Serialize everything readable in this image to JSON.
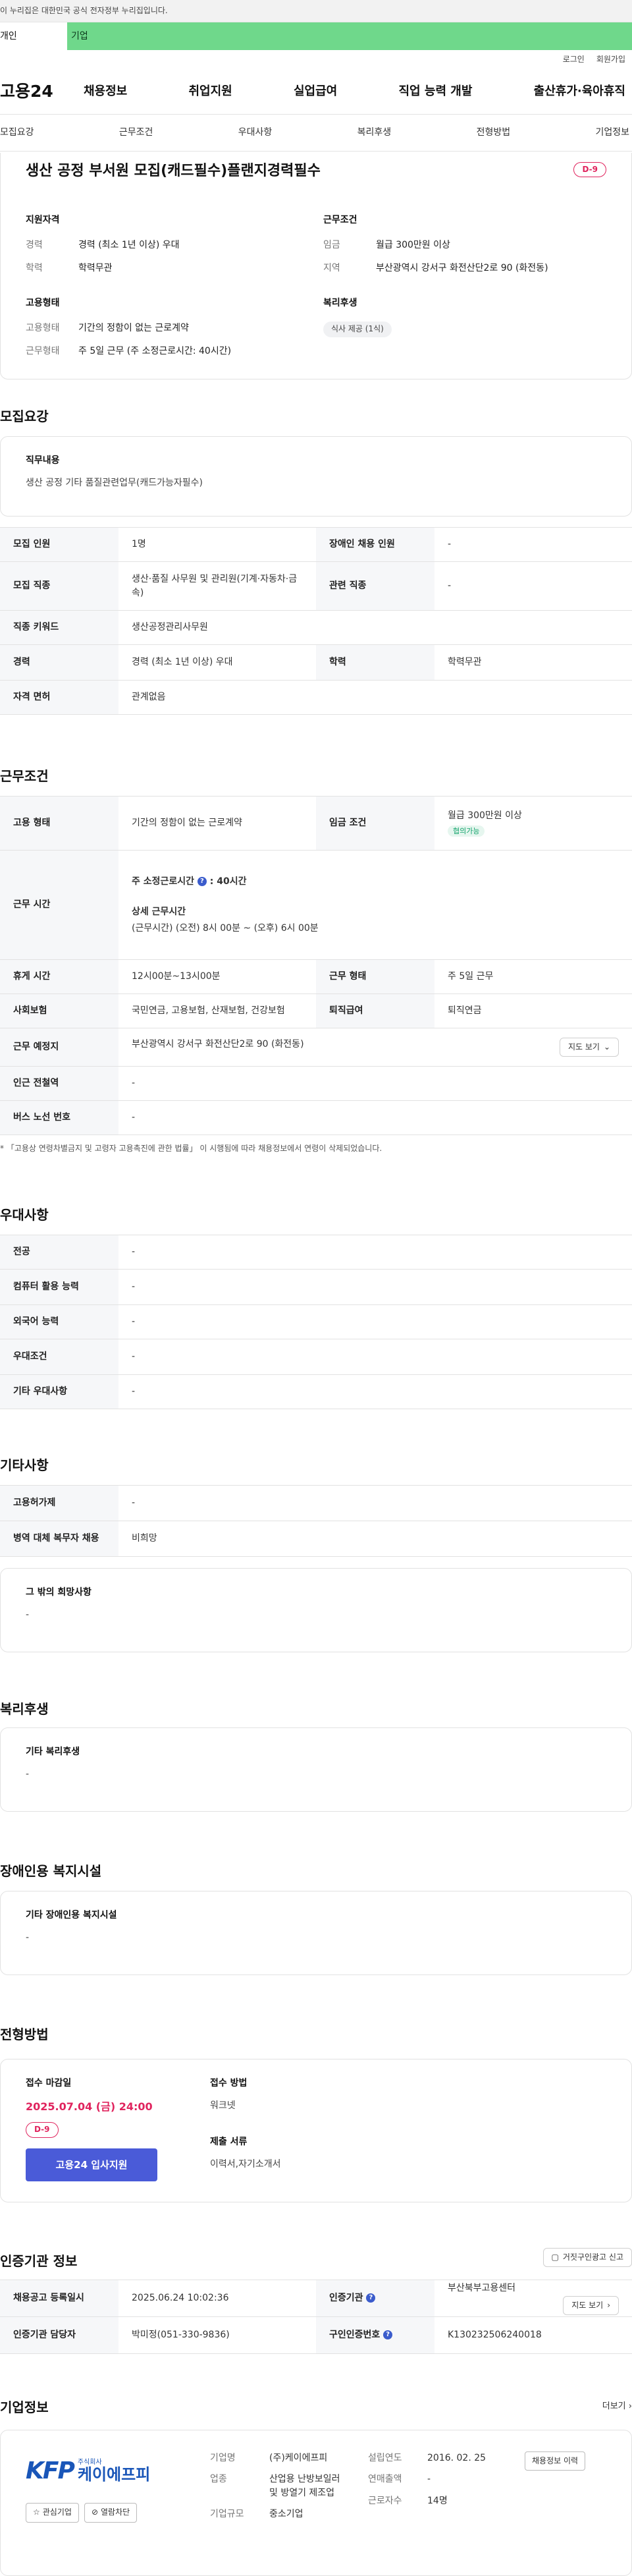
{
  "gov_banner": "이 누리집은 대한민국 공식 전자정부 누리집입니다.",
  "user_type": {
    "individual": "개인",
    "business": "기업"
  },
  "util": {
    "login": "로그인",
    "join": "회원가입"
  },
  "gnb": {
    "logo": "고용24",
    "menu": [
      "채용정보",
      "취업지원",
      "실업급여",
      "직업 능력 개발",
      "출산휴가·육아휴직"
    ]
  },
  "tabs": [
    "모집요강",
    "근무조건",
    "우대사항",
    "복리후생",
    "전형방법",
    "기업정보"
  ],
  "header": {
    "title": "생산 공정 부서원 모집(캐드필수)플랜지경력필수",
    "dday": "D-9",
    "qualification": {
      "heading": "지원자격",
      "rows": [
        {
          "k": "경력",
          "v": "경력 (최소 1년 이상) 우대"
        },
        {
          "k": "학력",
          "v": "학력무관"
        }
      ]
    },
    "conditions": {
      "heading": "근무조건",
      "rows": [
        {
          "k": "임금",
          "v": "월급 300만원 이상"
        },
        {
          "k": "지역",
          "v": "부산광역시 강서구 화전산단2로 90 (화전동)"
        }
      ]
    },
    "employment": {
      "heading": "고용형태",
      "rows": [
        {
          "k": "고용형태",
          "v": "기간의 정함이 없는 근로계약"
        },
        {
          "k": "근무형태",
          "v": "주 5일 근무 (주 소정근로시간: 40시간)"
        }
      ]
    },
    "welfare": {
      "heading": "복리후생",
      "chip": "식사 제공 (1식)"
    }
  },
  "recruit": {
    "title": "모집요강",
    "duty_label": "직무내용",
    "duty_value": "생산 공정  기타 품질관련업무(캐드가능자필수)",
    "rows": [
      [
        "모집 인원",
        "1명",
        "장애인 채용 인원",
        "-"
      ],
      [
        "모집 직종",
        "생산·품질 사무원 및 관리원(기계·자동차·금속)",
        "관련 직종",
        "-"
      ],
      [
        "직종 키워드",
        "생산공정관리사무원"
      ],
      [
        "경력",
        "경력 (최소 1년 이상) 우대",
        "학력",
        "학력무관"
      ],
      [
        "자격 면허",
        "관계없음"
      ]
    ]
  },
  "work": {
    "title": "근무조건",
    "emp_type_label": "고용 형태",
    "emp_type": "기간의 정함이 없는 근로계약",
    "wage_label": "임금 조건",
    "wage": "월급 300만원 이상",
    "wage_chip": "협의가능",
    "hours_label": "근무 시간",
    "weekly_hours_label": "주 소정근로시간",
    "weekly_hours": ": 40시간",
    "detail_label": "상세 근무시간",
    "detail_value": "(근무시간) (오전) 8시 00분 ~ (오후) 6시 00분",
    "break_label": "휴게 시간",
    "break_value": "12시00분~13시00분",
    "shift_label": "근무 형태",
    "shift_value": "주 5일 근무",
    "insurance_label": "사회보험",
    "insurance_value": "국민연금, 고용보험, 산재보험, 건강보험",
    "retire_label": "퇴직급여",
    "retire_value": "퇴직연금",
    "place_label": "근무 예정지",
    "place_value": "부산광역시 강서구 화전산단2로 90 (화전동)",
    "map_btn": "지도 보기",
    "subway_label": "인근 전철역",
    "subway_value": "-",
    "bus_label": "버스 노선 번호",
    "bus_value": "-",
    "note": "* 「고용상 연령차별금지 및 고령자 고용촉진에 관한 법률」 이 시행됨에 따라 채용정보에서 연령이 삭제되었습니다."
  },
  "pref": {
    "title": "우대사항",
    "rows": [
      [
        "전공",
        "-"
      ],
      [
        "컴퓨터 활용 능력",
        "-"
      ],
      [
        "외국어 능력",
        "-"
      ],
      [
        "우대조건",
        "-"
      ],
      [
        "기타 우대사항",
        "-"
      ]
    ]
  },
  "etc": {
    "title": "기타사항",
    "rows": [
      [
        "고용허가제",
        "-"
      ],
      [
        "병역 대체 복무자 채용",
        "비희망"
      ]
    ],
    "hope_label": "그 밖의 희망사항",
    "hope_value": "-"
  },
  "benefit": {
    "title": "복리후생",
    "label": "기타 복리후생",
    "value": "-"
  },
  "disabled": {
    "title": "장애인용 복지시설",
    "label": "기타 장애인용 복지시설",
    "value": "-"
  },
  "method": {
    "title": "전형방법",
    "deadline_label": "접수 마감일",
    "deadline": "2025.07.04 (금) 24:00",
    "dday": "D-9",
    "apply_btn": "고용24 입사지원",
    "method_label": "접수 방법",
    "method_value": "워크넷",
    "docs_label": "제출 서류",
    "docs_value": "이력서,자기소개서"
  },
  "agency": {
    "title": "인증기관 정보",
    "report_btn": "거짓구인광고 신고",
    "reg_label": "채용공고 등록일시",
    "reg_value": "2025.06.24 10:02:36",
    "inst_label": "인증기관",
    "inst_value": "부산북부고용센터",
    "map_btn": "지도 보기",
    "manager_label": "인증기관 담당자",
    "manager_value": "박미정(051-330-9836)",
    "num_label": "구인인증번호",
    "num_value": "K130232506240018"
  },
  "company": {
    "title": "기업정보",
    "more": "더보기",
    "logo_mark": "KFP",
    "logo_small": "주식회사",
    "logo_name": "케이에프피",
    "fav_btn": "관심기업",
    "block_btn": "열람차단",
    "name_label": "기업명",
    "name_value": "(주)케이에프피",
    "industry_label": "업종",
    "industry_value": "산업용 난방보일러 및 방열기 제조업",
    "size_label": "기업규모",
    "size_value": "중소기업",
    "founded_label": "설립연도",
    "founded_value": "2016. 02. 25",
    "sales_label": "연매출액",
    "sales_value": "-",
    "staff_label": "근로자수",
    "staff_value": "14명",
    "history_btn": "채용정보 이력"
  }
}
